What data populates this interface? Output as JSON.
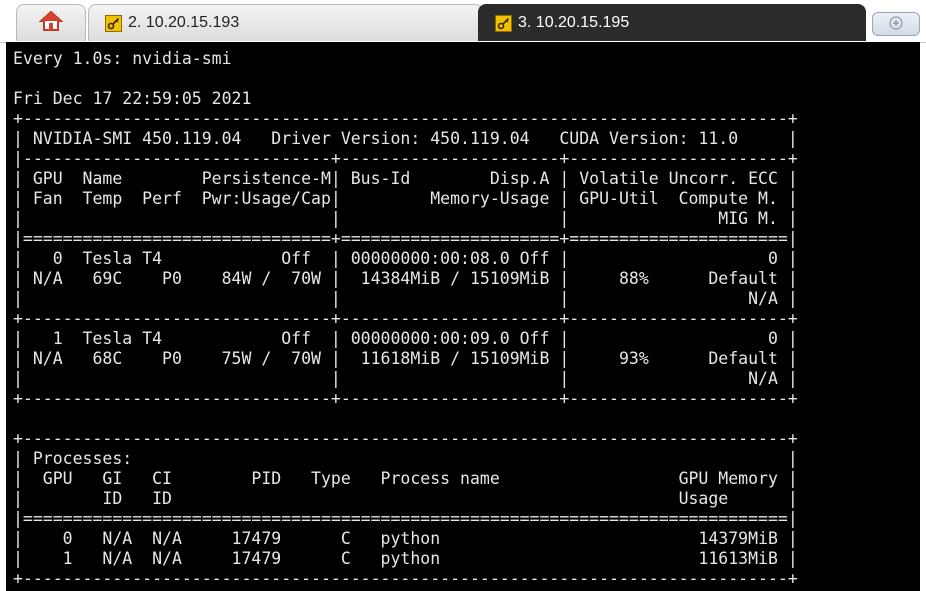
{
  "tabs": {
    "home_icon": "home-icon",
    "tab1_label": "2. 10.20.15.193",
    "tab2_label": "3. 10.20.15.195",
    "new_tab_icon": "plus-icon"
  },
  "colors": {
    "terminal_bg": "#000000",
    "terminal_fg": "#e6e6e6",
    "active_tab_bg": "#2b2b2b",
    "key_icon": "#f2c200"
  },
  "terminal": {
    "lines": [
      "Every 1.0s: nvidia-smi",
      "",
      "Fri Dec 17 22:59:05 2021",
      "+-----------------------------------------------------------------------------+",
      "| NVIDIA-SMI 450.119.04   Driver Version: 450.119.04   CUDA Version: 11.0     |",
      "|-------------------------------+----------------------+----------------------+",
      "| GPU  Name        Persistence-M| Bus-Id        Disp.A | Volatile Uncorr. ECC |",
      "| Fan  Temp  Perf  Pwr:Usage/Cap|         Memory-Usage | GPU-Util  Compute M. |",
      "|                               |                      |               MIG M. |",
      "|===============================+======================+======================|",
      "|   0  Tesla T4            Off  | 00000000:00:08.0 Off |                    0 |",
      "| N/A   69C    P0    84W /  70W |  14384MiB / 15109MiB |     88%      Default |",
      "|                               |                      |                  N/A |",
      "+-------------------------------+----------------------+----------------------+",
      "|   1  Tesla T4            Off  | 00000000:00:09.0 Off |                    0 |",
      "| N/A   68C    P0    75W /  70W |  11618MiB / 15109MiB |     93%      Default |",
      "|                               |                      |                  N/A |",
      "+-------------------------------+----------------------+----------------------+",
      "",
      "+-----------------------------------------------------------------------------+",
      "| Processes:                                                                  |",
      "|  GPU   GI   CI        PID   Type   Process name                  GPU Memory |",
      "|        ID   ID                                                   Usage      |",
      "|=============================================================================|",
      "|    0   N/A  N/A     17479      C   python                          14379MiB |",
      "|    1   N/A  N/A     17479      C   python                          11613MiB |",
      "+-----------------------------------------------------------------------------+"
    ]
  }
}
